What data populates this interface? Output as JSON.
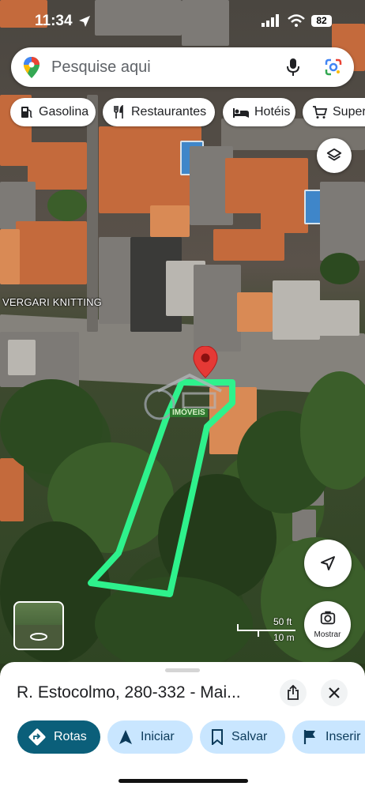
{
  "status_bar": {
    "time": "11:34",
    "battery": "82"
  },
  "search": {
    "placeholder": "Pesquise aqui"
  },
  "chips": [
    {
      "label": "Gasolina",
      "icon": "gas-station-icon"
    },
    {
      "label": "Restaurantes",
      "icon": "restaurant-icon"
    },
    {
      "label": "Hotéis",
      "icon": "hotel-icon"
    },
    {
      "label": "Super",
      "icon": "shopping-cart-icon"
    }
  ],
  "map": {
    "place_label": "VERGARI KNITTING",
    "watermark_text": "IMÓVEIS",
    "scale": {
      "feet": "50 ft",
      "meters": "10 m"
    },
    "show_label": "Mostrar"
  },
  "sheet": {
    "title": "R. Estocolmo, 280-332 - Mai...",
    "actions": [
      {
        "label": "Rotas",
        "icon": "directions-icon"
      },
      {
        "label": "Iniciar",
        "icon": "navigation-arrow-icon"
      },
      {
        "label": "Salvar",
        "icon": "bookmark-icon"
      },
      {
        "label": "Inserir",
        "icon": "flag-icon"
      }
    ]
  },
  "colors": {
    "accent": "#0b57d0",
    "rotas_bg": "#0b5f7a",
    "pill_bg": "#c9e6ff",
    "polygon": "#2ef28c",
    "pin": "#e53935"
  }
}
